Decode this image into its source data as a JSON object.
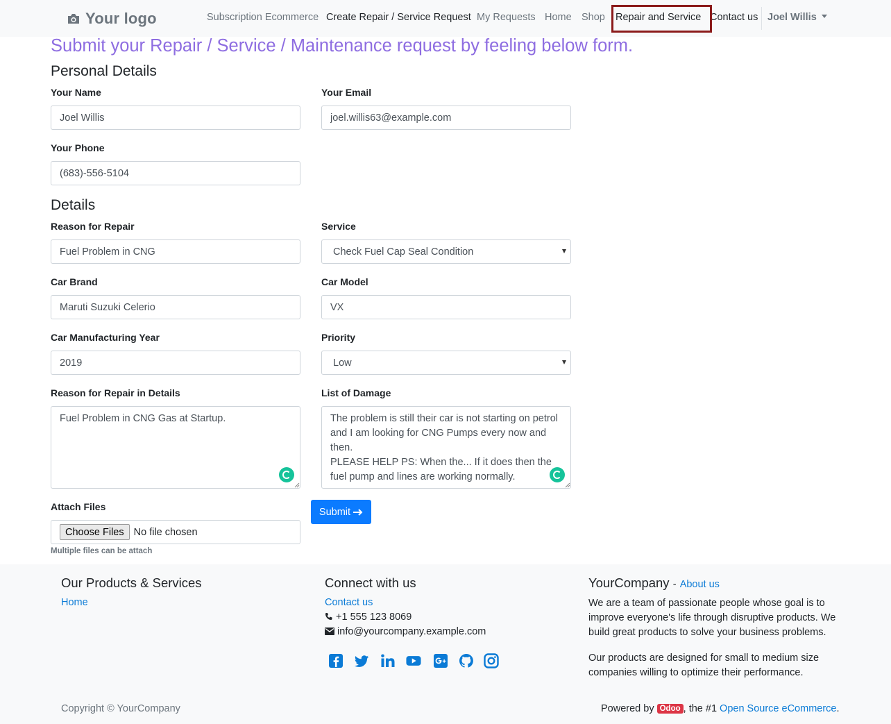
{
  "navbar": {
    "logo_text": "Your logo",
    "items": [
      {
        "label": "Subscription Ecommerce"
      },
      {
        "label": "Create Repair / Service Request"
      },
      {
        "label": "My Requests"
      },
      {
        "label": "Home"
      },
      {
        "label": "Shop"
      },
      {
        "label": "Repair and Service"
      },
      {
        "label": "Contact us"
      }
    ],
    "user": "Joel Willis",
    "highlighted_item": "Repair and Service"
  },
  "page": {
    "title": "Submit your Repair / Service / Maintenance request by feeling below form."
  },
  "personal": {
    "section_title": "Personal Details",
    "name_label": "Your Name",
    "name_value": "Joel Willis",
    "email_label": "Your Email",
    "email_value": "joel.willis63@example.com",
    "phone_label": "Your Phone",
    "phone_value": "(683)-556-5104"
  },
  "details": {
    "section_title": "Details",
    "reason_label": "Reason for Repair",
    "reason_value": "Fuel Problem in CNG",
    "service_label": "Service",
    "service_value": "Check Fuel Cap Seal Condition",
    "brand_label": "Car Brand",
    "brand_value": "Maruti Suzuki Celerio",
    "model_label": "Car Model",
    "model_value": "VX",
    "year_label": "Car Manufacturing Year",
    "year_value": "2019",
    "priority_label": "Priority",
    "priority_value": "Low",
    "reason_details_label": "Reason for Repair in Details",
    "reason_details_value": "Fuel Problem in CNG Gas at Startup.",
    "damage_label": "List of Damage",
    "damage_value": "The problem is still their car is not starting on petrol and I am looking for CNG Pumps every now and then.\nPLEASE HELP PS: When the... If it does then the fuel pump and lines are working normally.",
    "attach_label": "Attach Files",
    "choose_button": "Choose Files",
    "no_file_text": "No file chosen",
    "attach_help": "Multiple files can be attach",
    "submit_label": "Submit"
  },
  "footer": {
    "col1_title": "Our Products & Services",
    "col1_link": "Home",
    "col2_title": "Connect with us",
    "col2_link": "Contact us",
    "phone": "+1 555 123 8069",
    "email": "info@yourcompany.example.com",
    "social_icons": [
      "facebook-icon",
      "twitter-icon",
      "linkedin-icon",
      "youtube-icon",
      "google-plus-icon",
      "github-icon",
      "instagram-icon"
    ],
    "col3_title": "YourCompany",
    "col3_sep": "-",
    "col3_link": "About us",
    "para1": "We are a team of passionate people whose goal is to improve everyone's life through disruptive products. We build great products to solve your business problems.",
    "para2": "Our products are designed for small to medium size companies willing to optimize their performance.",
    "copyright": "Copyright © YourCompany",
    "powered_prefix": "Powered by",
    "odoo_badge": "Odoo",
    "powered_mid": ", the #1",
    "powered_link": "Open Source eCommerce",
    "powered_end": "."
  },
  "colors": {
    "title": "#8e6de1",
    "primary": "#0b7bff",
    "link": "#0b7bd6",
    "highlight_border": "#8b1a1a",
    "grammarly": "#15c39a",
    "odoo_badge": "#dc3545"
  }
}
